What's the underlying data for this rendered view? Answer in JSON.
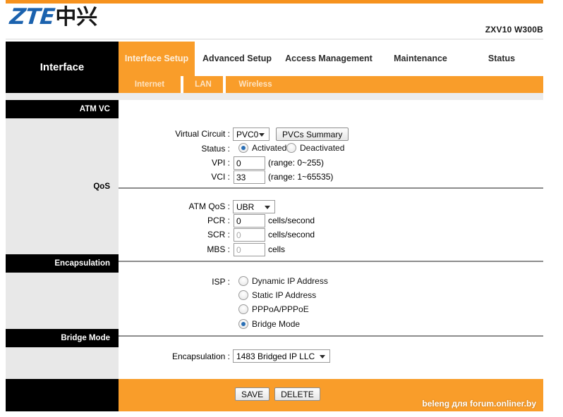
{
  "header": {
    "logo_latin": "ZTE",
    "logo_cjk": "中兴",
    "model": "ZXV10 W300B"
  },
  "nav": {
    "brand": "Interface",
    "tabs": [
      {
        "label": "Interface Setup",
        "active": true
      },
      {
        "label": "Advanced Setup",
        "active": false
      },
      {
        "label": "Access Management",
        "active": false
      },
      {
        "label": "Maintenance",
        "active": false
      },
      {
        "label": "Status",
        "active": false
      }
    ],
    "subtabs": [
      "Internet",
      "LAN",
      "Wireless"
    ]
  },
  "sections": {
    "atm_vc": "ATM VC",
    "qos": "QoS",
    "encapsulation": "Encapsulation",
    "bridge_mode": "Bridge Mode"
  },
  "atm_vc": {
    "virtual_circuit_label": "Virtual Circuit :",
    "virtual_circuit_value": "PVC0",
    "pvcs_summary_button": "PVCs Summary",
    "status_label": "Status :",
    "status_activated": "Activated",
    "status_deactivated": "Deactivated",
    "status_selected": "Activated",
    "vpi_label": "VPI :",
    "vpi_value": "0",
    "vpi_range": "(range: 0~255)",
    "vci_label": "VCI :",
    "vci_value": "33",
    "vci_range": "(range: 1~65535)"
  },
  "qos": {
    "atm_qos_label": "ATM QoS :",
    "atm_qos_value": "UBR",
    "pcr_label": "PCR :",
    "pcr_value": "0",
    "pcr_unit": "cells/second",
    "scr_label": "SCR :",
    "scr_value": "0",
    "scr_unit": "cells/second",
    "mbs_label": "MBS :",
    "mbs_value": "0",
    "mbs_unit": "cells"
  },
  "encapsulation": {
    "isp_label": "ISP :",
    "options": [
      "Dynamic IP Address",
      "Static IP Address",
      "PPPoA/PPPoE",
      "Bridge Mode"
    ],
    "selected": "Bridge Mode"
  },
  "bridge_mode": {
    "encapsulation_label": "Encapsulation :",
    "encapsulation_value": "1483 Bridged IP LLC"
  },
  "footer": {
    "save_label": "SAVE",
    "delete_label": "DELETE",
    "watermark": "beleng для forum.onliner.by"
  },
  "colors": {
    "orange": "#f99d2a",
    "brand_blue": "#1b62ae",
    "black": "#000000",
    "sidebar_gray": "#e8e8e8"
  }
}
